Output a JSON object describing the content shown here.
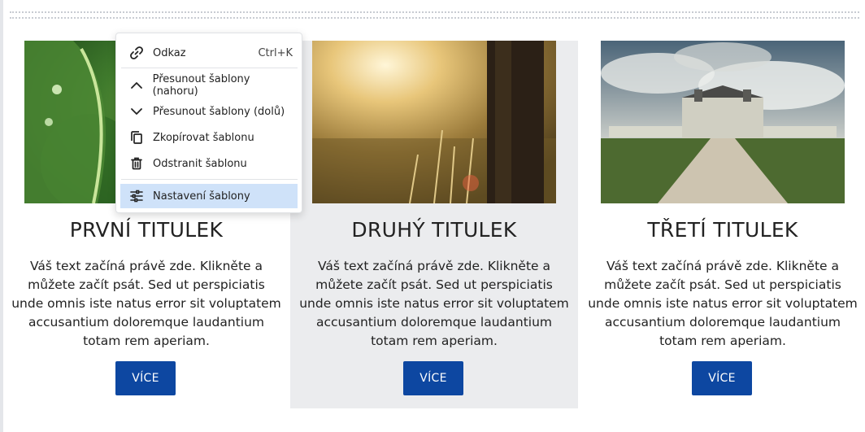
{
  "cards": [
    {
      "title": "PRVNÍ TITULEK",
      "text": "Váš text začíná právě zde. Klikněte a můžete začít psát. Sed ut perspiciatis unde omnis iste natus error sit voluptatem accusantium doloremque laudantium totam rem aperiam.",
      "button": "VÍCE",
      "image": "leaf-closeup"
    },
    {
      "title": "DRUHÝ TITULEK",
      "text": "Váš text začíná právě zde. Klikněte a můžete začít psát. Sed ut perspiciatis unde omnis iste natus error sit voluptatem accusantium doloremque laudantium totam rem aperiam.",
      "button": "VÍCE",
      "image": "sunlit-meadow-tree"
    },
    {
      "title": "TŘETÍ TITULEK",
      "text": "Váš text začíná právě zde. Klikněte a můžete začít psát. Sed ut perspiciatis unde omnis iste natus error sit voluptatem accusantium doloremque laudantium totam rem aperiam.",
      "button": "VÍCE",
      "image": "chateau-avenue"
    }
  ],
  "context_menu": {
    "items": [
      {
        "label": "Odkaz",
        "shortcut": "Ctrl+K",
        "icon": "link-icon"
      },
      {
        "label": "Přesunout šablony (nahoru)",
        "icon": "chevron-up-icon"
      },
      {
        "label": "Přesunout šablony (dolů)",
        "icon": "chevron-down-icon"
      },
      {
        "label": "Zkopírovat šablonu",
        "icon": "copy-icon"
      },
      {
        "label": "Odstranit šablonu",
        "icon": "trash-icon"
      },
      {
        "label": "Nastavení šablony",
        "icon": "settings-sliders-icon",
        "active": true
      }
    ]
  },
  "colors": {
    "button": "#0d47a1",
    "highlight_column": "#ebecee",
    "menu_active": "#cfe2f9"
  }
}
